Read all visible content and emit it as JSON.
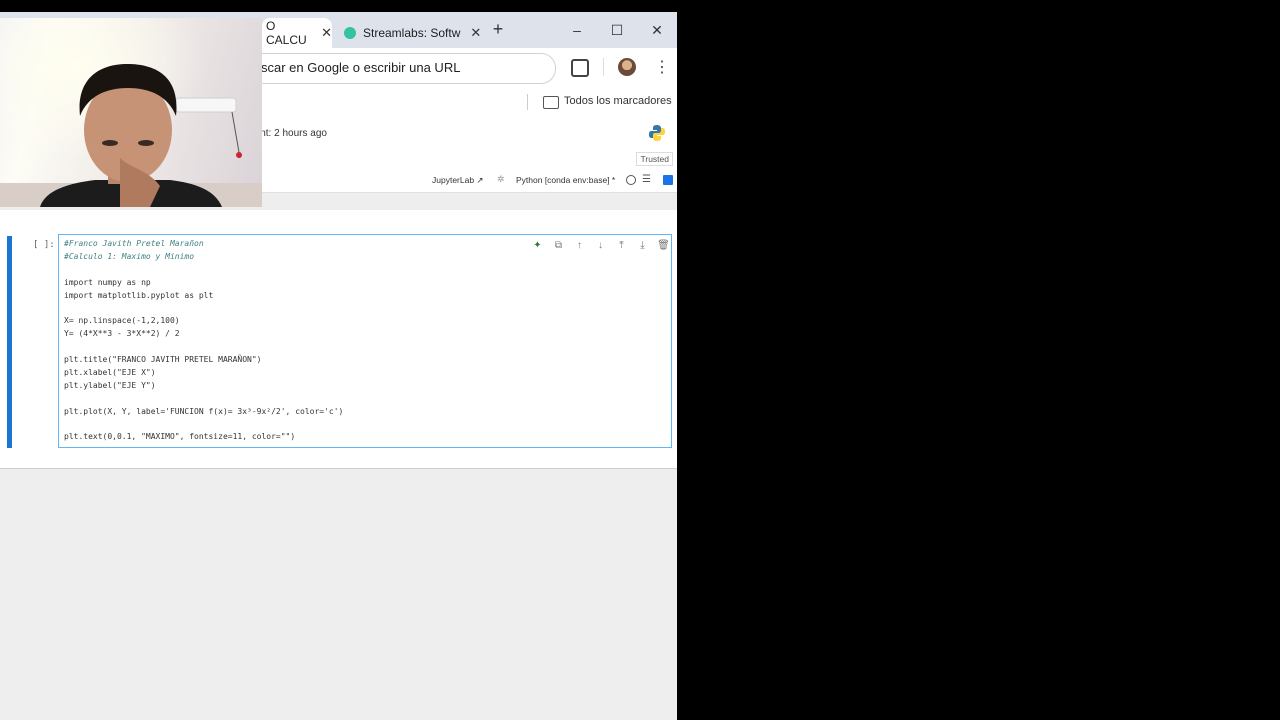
{
  "browser": {
    "tabs": [
      {
        "title": "O CALCU",
        "active": true
      },
      {
        "title": "Streamlabs: Softw",
        "active": false
      }
    ],
    "new_tab": "+",
    "window": {
      "minimize": "–",
      "maximize": "☐",
      "close": "✕"
    },
    "omnibox_text": "scar en Google o escribir una URL",
    "bookmarks_label": "Todos los marcadores"
  },
  "jupyter": {
    "checkpoint": "int: 2 hours ago",
    "trusted": "Trusted",
    "jupyterlab_link": "JupyterLab ↗",
    "kernel": "Python [conda env:base] *"
  },
  "cell": {
    "prompt": "[ ]:",
    "code_lines": [
      "#Franco Javith Pretel Marañon",
      "#Calculo 1: Maximo y Minimo",
      "",
      "import numpy as np",
      "import matplotlib.pyplot as plt",
      "",
      "X= np.linspace(-1,2,100)",
      "Y= (4*X**3 - 3*X**2) / 2",
      "",
      "plt.title(\"FRANCO JAVITH PRETEL MARAÑON\")",
      "plt.xlabel(\"EJE X\")",
      "plt.ylabel(\"EJE Y\")",
      "",
      "plt.plot(X, Y, label='FUNCION f(x)= 3x³-9x²/2', color='c')",
      "",
      "plt.text(0,0.1, \"MAXIMO\", fontsize=11, color=\"\")"
    ]
  },
  "colors": {
    "accent": "#1976d2",
    "cell_border": "#64b5f6",
    "tabstrip": "#dee3eb"
  }
}
